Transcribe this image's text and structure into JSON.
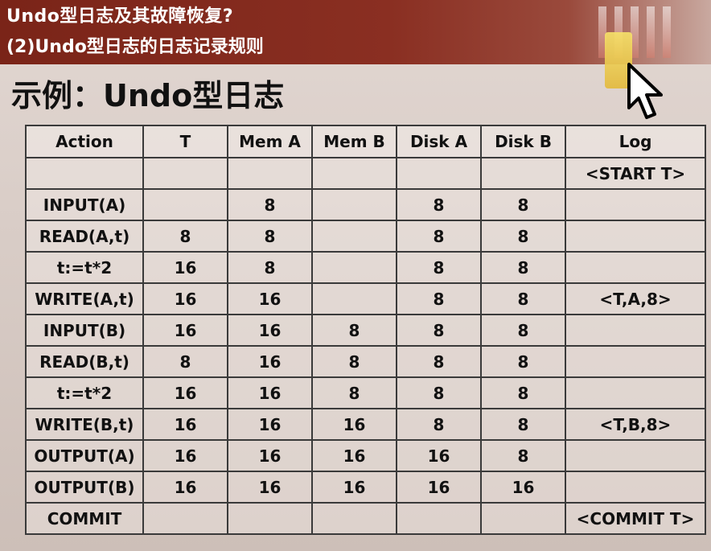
{
  "header": {
    "line1": "Undo型日志及其故障恢复?",
    "line2": "(2)Undo型日志的日志记录规则"
  },
  "slide": {
    "title": "示例：Undo型日志"
  },
  "table": {
    "columns": [
      "Action",
      "T",
      "Mem A",
      "Mem B",
      "Disk A",
      "Disk B",
      "Log"
    ],
    "rows": [
      [
        "",
        "",
        "",
        "",
        "",
        "",
        "<START T>"
      ],
      [
        "INPUT(A)",
        "",
        "8",
        "",
        "8",
        "8",
        ""
      ],
      [
        "READ(A,t)",
        "8",
        "8",
        "",
        "8",
        "8",
        ""
      ],
      [
        "t:=t*2",
        "16",
        "8",
        "",
        "8",
        "8",
        ""
      ],
      [
        "WRITE(A,t)",
        "16",
        "16",
        "",
        "8",
        "8",
        "<T,A,8>"
      ],
      [
        "INPUT(B)",
        "16",
        "16",
        "8",
        "8",
        "8",
        ""
      ],
      [
        "READ(B,t)",
        "8",
        "16",
        "8",
        "8",
        "8",
        ""
      ],
      [
        "t:=t*2",
        "16",
        "16",
        "8",
        "8",
        "8",
        ""
      ],
      [
        "WRITE(B,t)",
        "16",
        "16",
        "16",
        "8",
        "8",
        "<T,B,8>"
      ],
      [
        "OUTPUT(A)",
        "16",
        "16",
        "16",
        "16",
        "8",
        ""
      ],
      [
        "OUTPUT(B)",
        "16",
        "16",
        "16",
        "16",
        "16",
        ""
      ],
      [
        "COMMIT",
        "",
        "",
        "",
        "",
        "",
        "<COMMIT T>"
      ]
    ]
  },
  "icons": {
    "cursor": "mouse-pointer-icon"
  },
  "colors": {
    "header_bg": "#7a2418",
    "header_text": "#ffffff",
    "title_text": "#111111",
    "table_border": "#3a3a3a"
  }
}
